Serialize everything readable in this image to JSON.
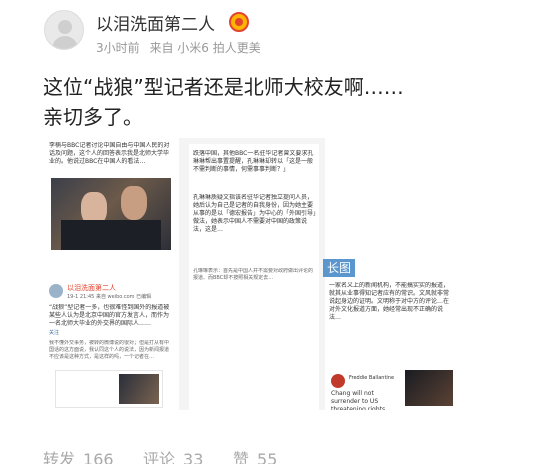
{
  "post": {
    "username": "以泪洗面第二人",
    "meta": {
      "time": "3小时前",
      "source": "来自 小米6 拍人更美"
    },
    "text_line1": "这位“战狼”型记者还是北师大校友啊……",
    "text_line2": "亲切多了。",
    "image_badge": "长图",
    "actions": {
      "repost_label": "转发",
      "repost_count": "166",
      "comment_label": "评论",
      "comment_count": "33",
      "like_label": "赞",
      "like_count": "55"
    }
  },
  "embedded": {
    "left_top": "李楠与BBC记者讨论中国自由与中国人民的对话及问题，这个人的回答表示我是北师大学毕业的。他说过BBC在中国人的看法…",
    "left_embed_name": "以泪洗面第二人",
    "left_embed_time": "19-1 21:45",
    "left_embed_source": "来自 weibo.com",
    "left_embed_extra": "已编辑",
    "left_quote": "“战狼”型记者一多，也很难怪到国外的报道被某些人认为是北京中国的官方发言人，而作为一名北师大毕业的外交界的国际人……",
    "left_footer_label": "关注",
    "left_comment": "我不懂外交事务，被转的微博说的很对；但是打从有中国话的这方面说，我认同这个人的说法，因为新闻报道不应该是这种方式，是这样的吗，一个记者在…",
    "right_text": "跌落中国，其他BBC一名驻华记者曾文要求孔琳琳帮出事置提醒，孔琳琳却转以「这是一般不需判断的事情，何需事事判断？」",
    "right_text2": "孔琳琳质疑文指该名驻华记者独立提问人员，她后认为自己是记者的自我身份，因为她主要从事的是以「德宏报告」为中心的「外国引导」做法，她表示中国人不需要对中国的政策说法，这是…",
    "right_text3": "孔琳琳表示：首先是中国人并不需要对政府做出评论的报道、而BBC却不按照相关规定去…",
    "far_text": "一家名义上的新闻机构，不能搞实实的报道，就其从业事得知记者应有的常识。文风就非常说起身边的证明。文明称于对中方的评论…在对外文化报道方面，她经常出现不正确的说法…",
    "tweet_name": "Freddie Ballantine",
    "tweet_text": "Chang will not surrender to US threatening rights. Follow us now!"
  }
}
